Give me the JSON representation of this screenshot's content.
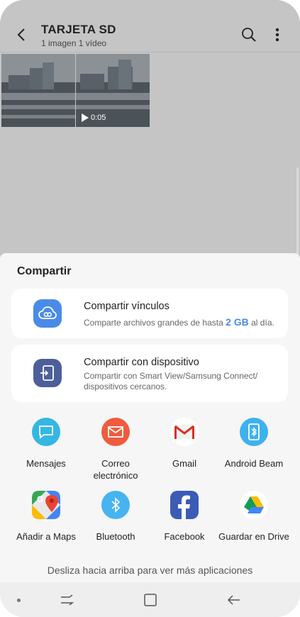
{
  "gallery": {
    "title": "TARJETA SD",
    "subtitle": "1 imagen  1 vídeo",
    "video_duration": "0:05"
  },
  "share": {
    "title": "Compartir",
    "link_share": {
      "title": "Compartir vínculos",
      "desc_prefix": "Comparte archivos grandes de hasta ",
      "desc_highlight": "2 GB",
      "desc_suffix": " al día."
    },
    "device_share": {
      "title": "Compartir con dispositivo",
      "desc": "Compartir con Smart View/Samsung Connect/ dispositivos cercanos."
    },
    "apps": [
      {
        "label": "Mensajes",
        "icon": "messages-icon",
        "color": "#35b6e3"
      },
      {
        "label": "Correo electrónico",
        "icon": "email-icon",
        "color": "#f15a3e"
      },
      {
        "label": "Gmail",
        "icon": "gmail-icon",
        "color": "#ffffff"
      },
      {
        "label": "Android Beam",
        "icon": "android-beam-icon",
        "color": "#3eb1f1"
      },
      {
        "label": "Añadir a Maps",
        "icon": "maps-icon",
        "color": "#ffffff"
      },
      {
        "label": "Bluetooth",
        "icon": "bluetooth-icon",
        "color": "#46b4f0"
      },
      {
        "label": "Facebook",
        "icon": "facebook-icon",
        "color": "#3b5bb5"
      },
      {
        "label": "Guardar en Drive",
        "icon": "drive-icon",
        "color": "#ffffff"
      }
    ],
    "hint": "Desliza hacia arriba para ver más aplicaciones"
  }
}
